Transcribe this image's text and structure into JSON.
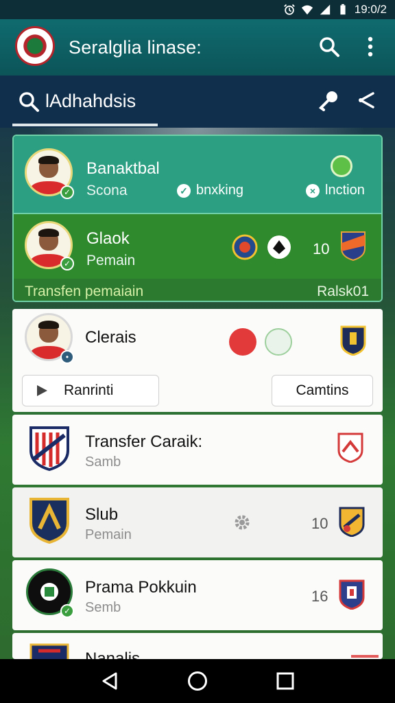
{
  "status_bar": {
    "time": "19:0/2"
  },
  "app_bar": {
    "title": "Seralglia linase:"
  },
  "search": {
    "text": "lAdhahdsis"
  },
  "highlight": {
    "row1": {
      "name": "Banaktbal",
      "sub": "Scona",
      "chip1": "bnxking",
      "chip2": "lnction"
    },
    "row2": {
      "name": "Glaok",
      "sub": "Pemain",
      "number": "10"
    },
    "footer_left": "Transfen pemaiain",
    "footer_right": "Ralsk01"
  },
  "cards": [
    {
      "name": "Clerais",
      "button_left": "Ranrinti",
      "button_right": "Camtins"
    },
    {
      "name": "Transfer Caraik:",
      "sub": "Samb"
    },
    {
      "name": "Slub",
      "sub": "Pemain",
      "number": "10"
    },
    {
      "name": "Prama Pokkuin",
      "sub": "Semb",
      "number": "16"
    },
    {
      "name": "Nanalis"
    }
  ],
  "colors": {
    "app_bar": "#0f6b6f",
    "search_bar": "#102f4c",
    "highlight_top": "#2c9f83",
    "highlight_bottom": "#2f8a2e",
    "card": "#fbfbfa"
  },
  "icons": [
    "search-icon",
    "more-icon",
    "key-icon",
    "share-icon",
    "back-icon",
    "home-icon",
    "recents-icon",
    "play-icon",
    "settings-icon"
  ]
}
